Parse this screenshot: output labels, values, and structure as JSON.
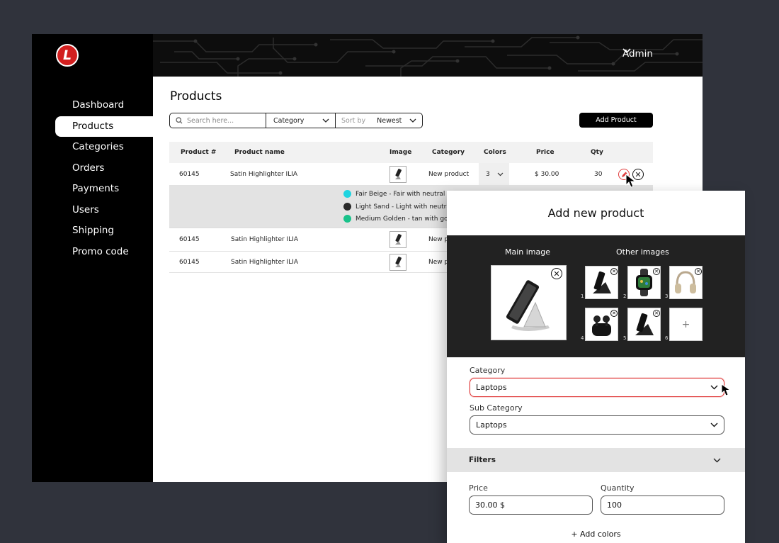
{
  "brand": {
    "logo_letter": "L",
    "accent": "#d21f1f"
  },
  "sidebar": {
    "items": [
      {
        "label": "Dashboard"
      },
      {
        "label": "Products",
        "active": true
      },
      {
        "label": "Categories"
      },
      {
        "label": "Orders"
      },
      {
        "label": "Payments"
      },
      {
        "label": "Users"
      },
      {
        "label": "Shipping"
      },
      {
        "label": "Promo code"
      }
    ]
  },
  "header": {
    "user": "Admin"
  },
  "page": {
    "title": "Products",
    "search_placeholder": "Search here...",
    "category_filter": "Category",
    "sort_label": "Sort by",
    "sort_value": "Newest",
    "add_button": "Add Product"
  },
  "table": {
    "headers": [
      "Product #",
      "Product name",
      "Image",
      "Category",
      "Colors",
      "Price",
      "Qty"
    ],
    "rows": [
      {
        "id": "60145",
        "name": "Satin Highlighter ILIA",
        "category": "New product",
        "colors": "3",
        "price": "$ 30.00",
        "qty": "30"
      },
      {
        "id": "60145",
        "name": "Satin Highlighter ILIA",
        "category": "New p"
      },
      {
        "id": "60145",
        "name": "Satin Highlighter ILIA",
        "category": "New p"
      }
    ],
    "expanded_colors": [
      {
        "label": "Fair Beige - Fair with neutral u",
        "color": "#1fd4e0"
      },
      {
        "label": "Light Sand - Light with neutral",
        "color": "#2a2a2a"
      },
      {
        "label": "Medium Golden - tan with gol",
        "color": "#19c28a"
      }
    ]
  },
  "modal": {
    "title": "Add new product",
    "main_image_label": "Main image",
    "other_images_label": "Other images",
    "other_images": [
      {
        "num": "1",
        "icon": "phone-stand-icon"
      },
      {
        "num": "2",
        "icon": "smartwatch-icon"
      },
      {
        "num": "3",
        "icon": "headphones-icon"
      },
      {
        "num": "4",
        "icon": "earbuds-icon"
      },
      {
        "num": "5",
        "icon": "phone-stand-icon"
      },
      {
        "num": "6",
        "icon": "add-icon",
        "add": "+"
      }
    ],
    "category_label": "Category",
    "category_value": "Laptops",
    "subcategory_label": "Sub Category",
    "subcategory_value": "Laptops",
    "filters_label": "Filters",
    "price_label": "Price",
    "price_value": "30.00 $",
    "quantity_label": "Quantity",
    "quantity_value": "100",
    "add_colors": "+ Add colors"
  }
}
